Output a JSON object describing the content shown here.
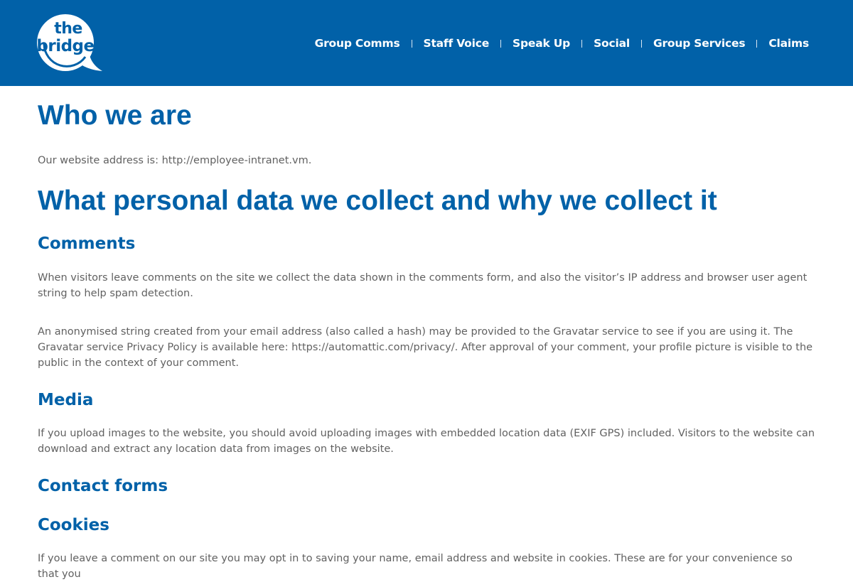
{
  "logo": {
    "line1": "the",
    "line2": "bridge"
  },
  "nav": {
    "items": [
      {
        "label": "Group Comms"
      },
      {
        "label": "Staff Voice"
      },
      {
        "label": "Speak Up"
      },
      {
        "label": "Social"
      },
      {
        "label": "Group Services"
      },
      {
        "label": "Claims"
      }
    ]
  },
  "content": {
    "heading_who": "Who we are",
    "para_address": "Our website address is: http://employee-intranet.vm.",
    "heading_personal_data": "What personal data we collect and why we collect it",
    "heading_comments": "Comments",
    "para_comments_1": "When visitors leave comments on the site we collect the data shown in the comments form, and also the visitor’s IP address and browser user agent string to help spam detection.",
    "para_comments_2": "An anonymised string created from your email address (also called a hash) may be provided to the Gravatar service to see if you are using it. The Gravatar service Privacy Policy is available here: https://automattic.com/privacy/. After approval of your comment, your profile picture is visible to the public in the context of your comment.",
    "heading_media": "Media",
    "para_media": "If you upload images to the website, you should avoid uploading images with embedded location data (EXIF GPS) included. Visitors to the website can download and extract any location data from images on the website.",
    "heading_contact_forms": "Contact forms",
    "heading_cookies": "Cookies",
    "para_cookies": "If you leave a comment on our site you may opt in to saving your name, email address and website in cookies. These are for your convenience so that you"
  },
  "colors": {
    "brand_blue": "#0161a8",
    "body_text": "#616161",
    "nav_text": "#ffffff"
  }
}
